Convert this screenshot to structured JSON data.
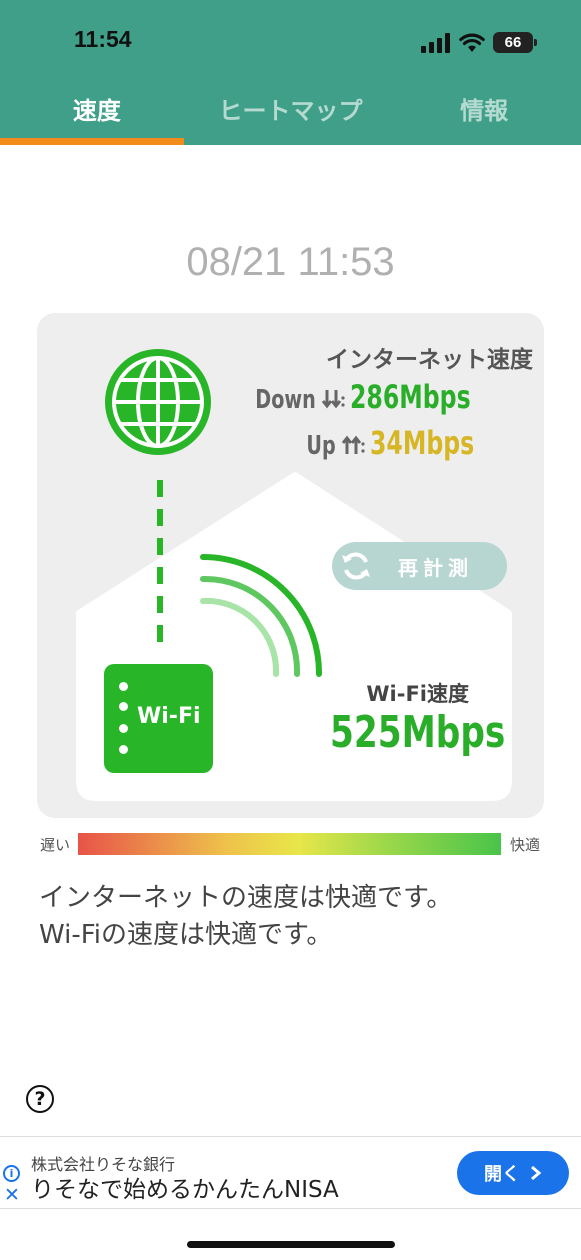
{
  "status_bar": {
    "time": "11:54",
    "battery": "66"
  },
  "tabs": [
    {
      "label": "速度",
      "active": true
    },
    {
      "label": "ヒートマップ",
      "active": false
    },
    {
      "label": "情報",
      "active": false
    }
  ],
  "timestamp": "08/21 11:53",
  "internet": {
    "title": "インターネット速度",
    "down_label": "Down",
    "down_value": "286Mbps",
    "up_label": "Up",
    "up_value": "34Mbps"
  },
  "remeasure_label": "再計測",
  "wifi": {
    "router_label": "Wi-Fi",
    "title": "Wi-Fi速度",
    "value": "525Mbps"
  },
  "scale": {
    "slow_label": "遅い",
    "fast_label": "快適"
  },
  "message": {
    "line1": "インターネットの速度は快適です。",
    "line2": "Wi-Fiの速度は快適です。"
  },
  "help_icon": "question-circle-icon",
  "ad": {
    "company": "株式会社りそな銀行",
    "headline": "りそなで始めるかんたんNISA",
    "button_label": "開く"
  },
  "colors": {
    "header": "#3f9f89",
    "tab_indicator": "#f28a1c",
    "green": "#2aae2a",
    "upload_yellow": "#d6b625",
    "ad_button": "#1a73e8"
  }
}
